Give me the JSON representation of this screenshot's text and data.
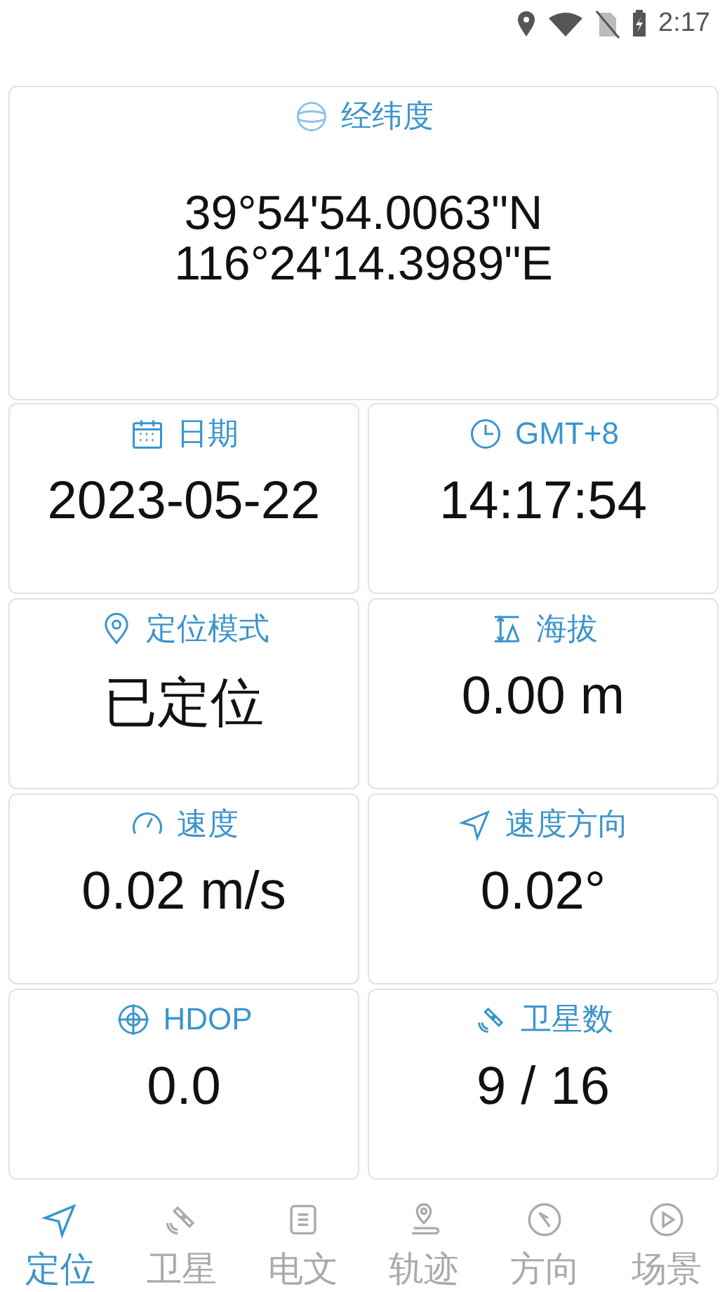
{
  "status_bar": {
    "time": "2:17"
  },
  "coordinates": {
    "label": "经纬度",
    "latitude": "39°54'54.0063\"N",
    "longitude": "116°24'14.3989\"E"
  },
  "tiles": [
    {
      "label": "日期",
      "value": "2023-05-22"
    },
    {
      "label": "GMT+8",
      "value": "14:17:54"
    },
    {
      "label": "定位模式",
      "value": "已定位"
    },
    {
      "label": "海拔",
      "value": "0.00 m"
    },
    {
      "label": "速度",
      "value": "0.02 m/s"
    },
    {
      "label": "速度方向",
      "value": "0.02°"
    },
    {
      "label": "HDOP",
      "value": "0.0"
    },
    {
      "label": "卫星数",
      "value": "9 / 16"
    }
  ],
  "tabs": [
    {
      "label": "定位",
      "selected": true
    },
    {
      "label": "卫星",
      "selected": false
    },
    {
      "label": "电文",
      "selected": false
    },
    {
      "label": "轨迹",
      "selected": false
    },
    {
      "label": "方向",
      "selected": false
    },
    {
      "label": "场景",
      "selected": false
    }
  ]
}
